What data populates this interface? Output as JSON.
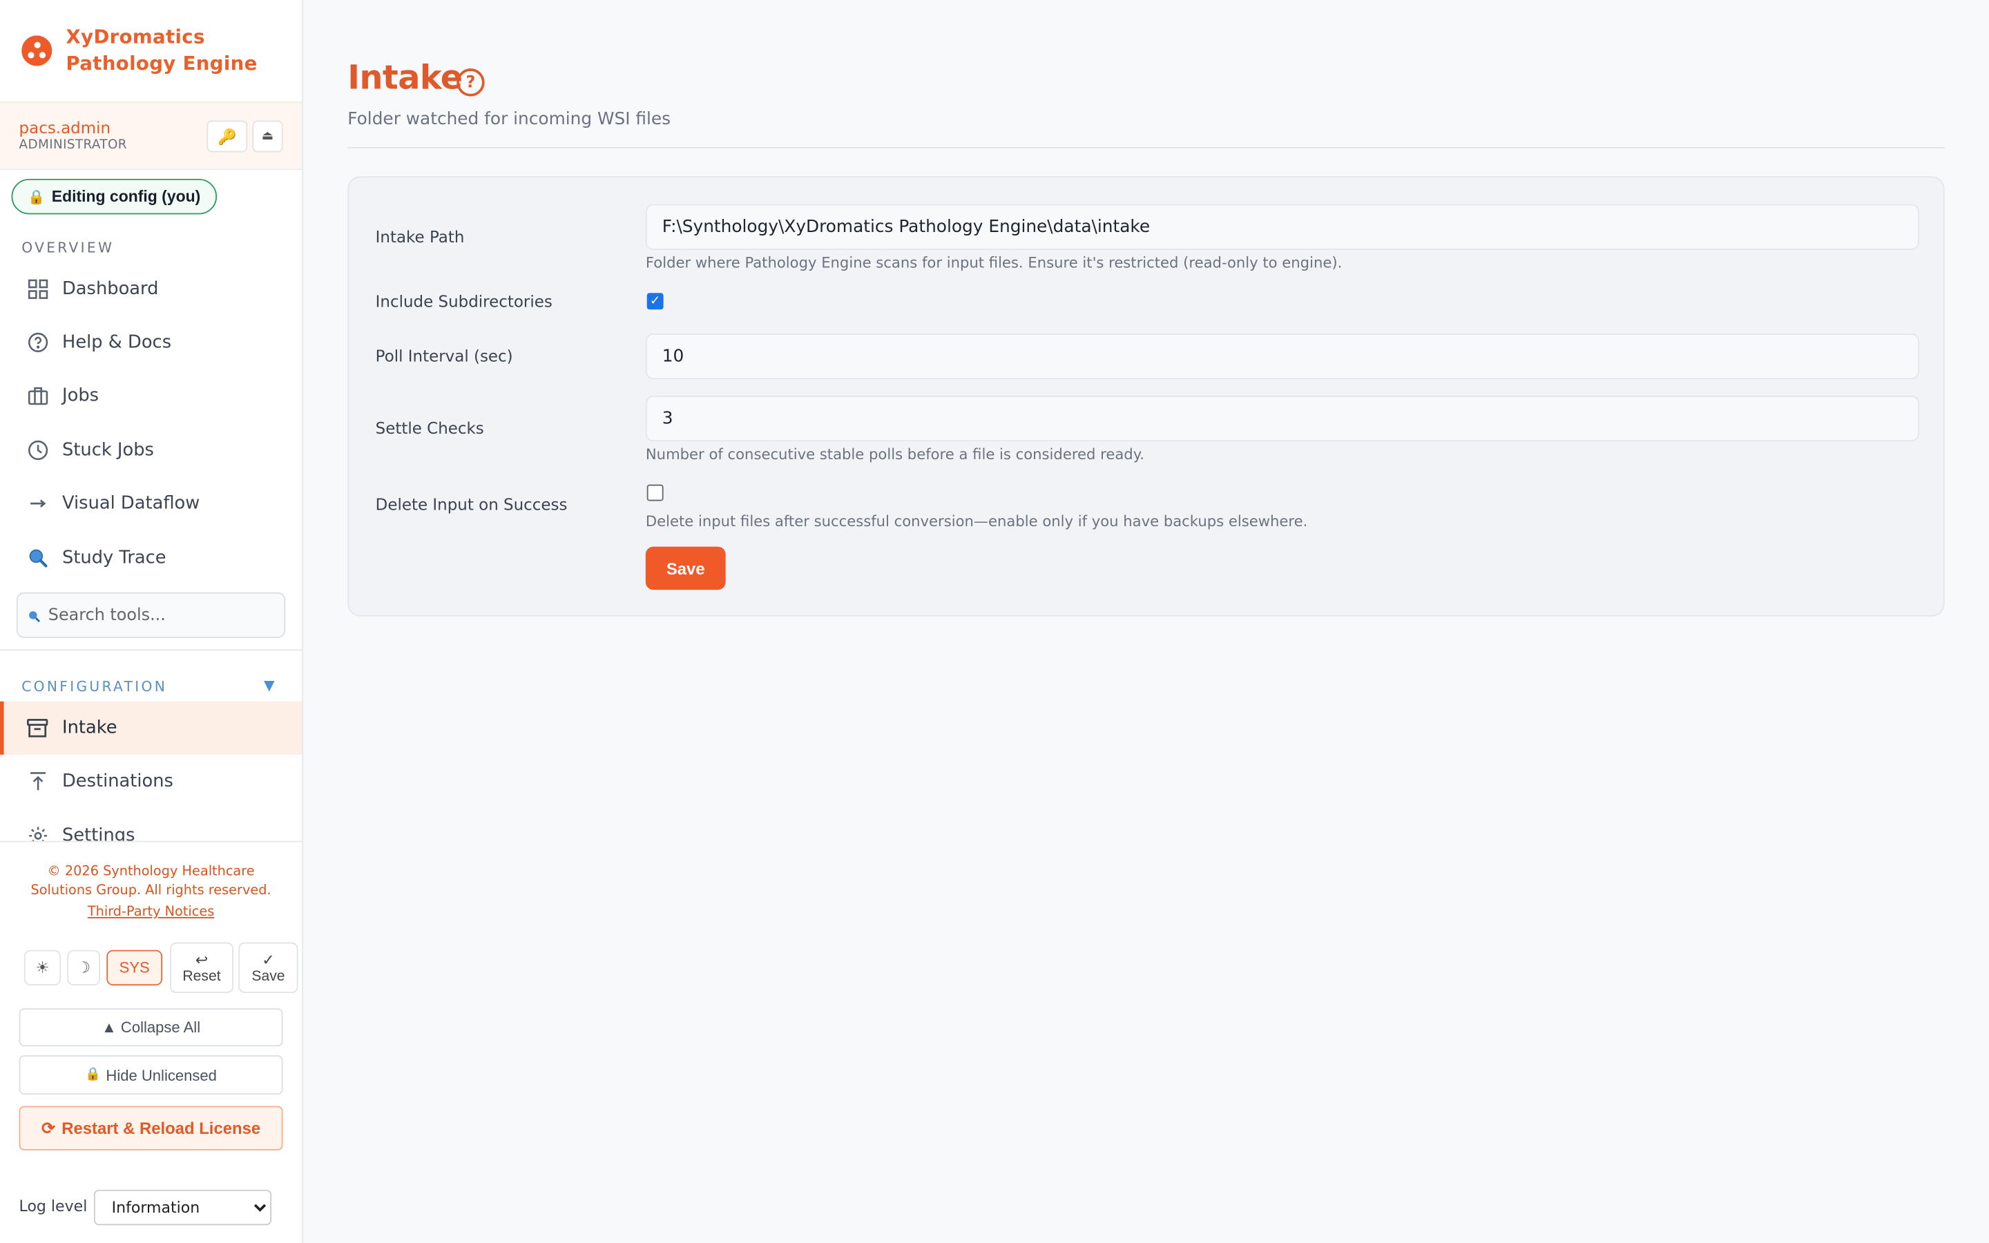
{
  "brand": {
    "line1": "XyDromatics",
    "line2": "Pathology Engine"
  },
  "user": {
    "name": "pacs.admin",
    "role": "ADMINISTRATOR",
    "key_icon": "key-icon",
    "eject_icon": "eject-icon"
  },
  "edit_badge": {
    "label": "Editing config (you)"
  },
  "sections": {
    "overview": "OVERVIEW",
    "configuration": "CONFIGURATION"
  },
  "nav_overview": [
    {
      "label": "Dashboard",
      "icon": "grid-icon"
    },
    {
      "label": "Help & Docs",
      "icon": "help-circle-icon"
    },
    {
      "label": "Jobs",
      "icon": "briefcase-icon"
    },
    {
      "label": "Stuck Jobs",
      "icon": "clock-icon"
    },
    {
      "label": "Visual Dataflow",
      "icon": "arrow-right-icon"
    },
    {
      "label": "Study Trace",
      "icon": "magnifier-icon"
    }
  ],
  "search": {
    "placeholder": "Search tools..."
  },
  "nav_config": [
    {
      "label": "Intake",
      "icon": "inbox-icon"
    },
    {
      "label": "Destinations",
      "icon": "upload-icon"
    },
    {
      "label": "Settings",
      "icon": "gear-icon"
    }
  ],
  "footer": {
    "copyright_line1": "© 2026 Synthology Healthcare",
    "copyright_line2": "Solutions Group. All rights reserved.",
    "notices": "Third-Party Notices"
  },
  "theme": {
    "light": "☀",
    "dark": "☽",
    "sys": "SYS"
  },
  "actions": {
    "reset_icon": "↩",
    "reset": "Reset",
    "save_icon": "✓",
    "save": "Save"
  },
  "buttons": {
    "collapse_all": "▲ Collapse All",
    "hide_unlicensed": "Hide Unlicensed",
    "restart_license": "Restart & Reload License"
  },
  "log": {
    "label": "Log level",
    "selected": "Information"
  },
  "page": {
    "title": "Intake",
    "subtitle": "Folder watched for incoming WSI files",
    "fields": {
      "intake_path": {
        "label": "Intake Path",
        "value": "F:\\Synthology\\XyDromatics Pathology Engine\\data\\intake",
        "hint": "Folder where Pathology Engine scans for input files. Ensure it's restricted (read-only to engine)."
      },
      "include_subdirs": {
        "label": "Include Subdirectories",
        "checked": true
      },
      "poll_interval": {
        "label": "Poll Interval (sec)",
        "value": "10"
      },
      "settle_checks": {
        "label": "Settle Checks",
        "value": "3",
        "hint": "Number of consecutive stable polls before a file is considered ready."
      },
      "delete_input": {
        "label": "Delete Input on Success",
        "checked": false,
        "hint": "Delete input files after successful conversion—enable only if you have backups elsewhere."
      }
    },
    "save_label": "Save"
  },
  "colors": {
    "accent": "#f05a28",
    "active_bg": "#fdeee6",
    "edit_border": "#2e9a5c"
  }
}
